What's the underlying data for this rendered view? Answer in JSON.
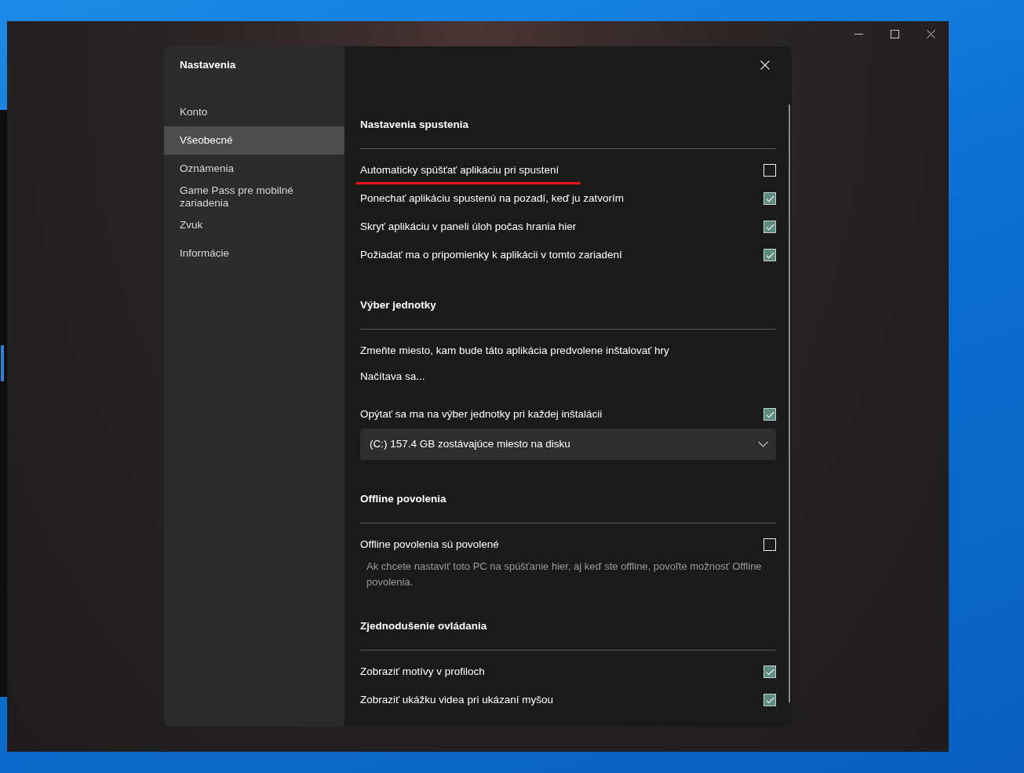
{
  "dialog": {
    "title": "Nastavenia",
    "nav": [
      {
        "label": "Konto",
        "selected": false
      },
      {
        "label": "Všeobecné",
        "selected": true
      },
      {
        "label": "Oznámenia",
        "selected": false
      },
      {
        "label": "Game Pass pre mobilné zariadenia",
        "selected": false
      },
      {
        "label": "Zvuk",
        "selected": false
      },
      {
        "label": "Informácie",
        "selected": false
      }
    ],
    "sections": [
      {
        "title": "Nastavenia spustenia",
        "items": [
          {
            "kind": "checkbox",
            "label": "Automaticky spúšťať aplikáciu pri spustení",
            "checked": false,
            "underlined": true
          },
          {
            "kind": "checkbox",
            "label": "Ponechať aplikáciu spustenú na pozadí, keď ju zatvorím",
            "checked": true,
            "underlined": false
          },
          {
            "kind": "checkbox",
            "label": "Skryť aplikáciu v paneli úloh počas hrania hier",
            "checked": true,
            "underlined": false
          },
          {
            "kind": "checkbox",
            "label": "Požiadať ma o pripomienky k aplikácii v tomto zariadení",
            "checked": true,
            "underlined": false
          }
        ]
      },
      {
        "title": "Výber jednotky",
        "items": [
          {
            "kind": "text",
            "label": "Zmeňte miesto, kam bude táto aplikácia predvolene inštalovať hry"
          },
          {
            "kind": "status",
            "label": "Načítava sa..."
          },
          {
            "kind": "checkbox",
            "label": "Opýtať sa ma na výber jednotky pri každej inštalácii",
            "checked": true,
            "underlined": false
          },
          {
            "kind": "dropdown",
            "value": "(C:) 157.4 GB zostávajúce miesto na disku"
          }
        ]
      },
      {
        "title": "Offline povolenia",
        "items": [
          {
            "kind": "checkbox",
            "label": "Offline povolenia sú povolené",
            "checked": false,
            "underlined": false
          },
          {
            "kind": "hint",
            "label": "Ak chcete nastaviť toto PC na spúšťanie hier, aj keď ste offline, povoľte možnosť Offline povolenia."
          }
        ]
      },
      {
        "title": "Zjednodušenie ovládania",
        "items": [
          {
            "kind": "checkbox",
            "label": "Zobraziť motívy v profiloch",
            "checked": true,
            "underlined": false
          },
          {
            "kind": "checkbox",
            "label": "Zobraziť ukážku videa pri ukázaní myšou",
            "checked": true,
            "underlined": false
          }
        ]
      }
    ]
  }
}
